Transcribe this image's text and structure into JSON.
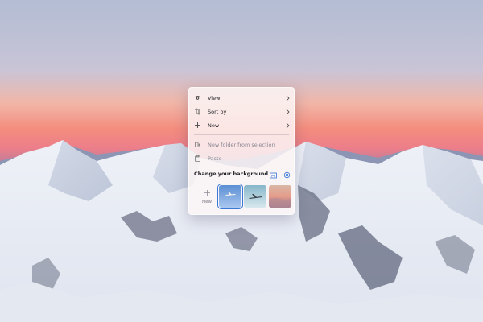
{
  "context_menu": {
    "items": [
      {
        "label": "View",
        "icon": "view-icon",
        "submenu": true
      },
      {
        "label": "Sort by",
        "icon": "sort-icon",
        "submenu": true
      },
      {
        "label": "New",
        "icon": "plus-icon",
        "submenu": true
      },
      {
        "label": "New folder from selection",
        "icon": "new-folder-icon",
        "submenu": false,
        "disabled": true
      },
      {
        "label": "Paste",
        "icon": "paste-icon",
        "submenu": false,
        "disabled": true
      }
    ],
    "background_section": {
      "title": "Change your background",
      "new_label": "New",
      "thumbnails": [
        "blue-airplane-thumbnail",
        "teal-airplane-thumbnail",
        "sunset-clouds-thumbnail"
      ],
      "selected_index": 0
    }
  },
  "colors": {
    "accent": "#3b79d8"
  }
}
